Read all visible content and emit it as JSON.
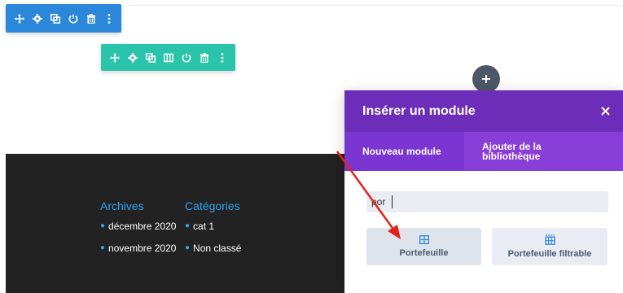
{
  "section_toolbar": {
    "icons": [
      "move-icon",
      "gear-icon",
      "duplicate-icon",
      "power-icon",
      "trash-icon",
      "more-vertical-icon"
    ]
  },
  "row_toolbar": {
    "icons": [
      "move-icon",
      "gear-icon",
      "duplicate-icon",
      "columns-icon",
      "power-icon",
      "trash-icon",
      "more-vertical-icon"
    ]
  },
  "footer": {
    "archives": {
      "title": "Archives",
      "items": [
        {
          "label": "décembre 2020"
        },
        {
          "label": "novembre 2020"
        }
      ]
    },
    "categories": {
      "title": "Catégories",
      "items": [
        {
          "label": "cat 1"
        },
        {
          "label": "Non classé"
        }
      ]
    }
  },
  "add_module_icon": "plus-icon",
  "modal": {
    "title": "Insérer un module",
    "close_icon": "close-icon",
    "tabs": [
      {
        "label": "Nouveau module",
        "active": true
      },
      {
        "label": "Ajouter de la bibliothèque",
        "active": false
      }
    ],
    "search": {
      "value": "por",
      "placeholder": ""
    },
    "modules": [
      {
        "label": "Portefeuille",
        "icon": "grid-icon"
      },
      {
        "label": "Portefeuille filtrable",
        "icon": "filterable-grid-icon"
      }
    ]
  },
  "annotation": {
    "arrow_color": "#e2231a"
  },
  "colors": {
    "section_toolbar": "#2b87da",
    "row_toolbar": "#29c4a9",
    "modal_header": "#6c2eb9",
    "tabs_bar": "#8a3ed8",
    "footer_bg": "#222222",
    "link_blue": "#2ea3f2"
  }
}
